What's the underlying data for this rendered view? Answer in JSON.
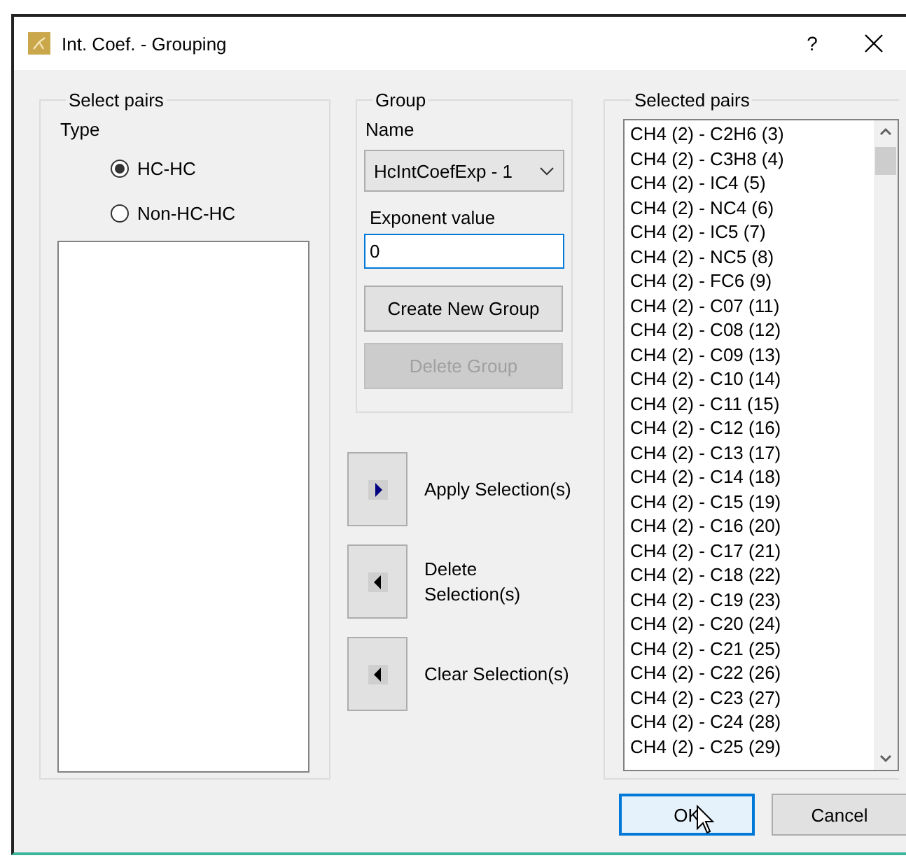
{
  "window": {
    "title": "Int. Coef. - Grouping",
    "help": "?"
  },
  "select_pairs": {
    "title": "Select pairs",
    "type_label": "Type",
    "options": [
      {
        "label": "HC-HC",
        "selected": true
      },
      {
        "label": "Non-HC-HC",
        "selected": false
      }
    ]
  },
  "group": {
    "title": "Group",
    "name_label": "Name",
    "name_value": "HcIntCoefExp - 1",
    "exponent_label": "Exponent value",
    "exponent_value": "0",
    "buttons": [
      {
        "label": "Create New Group",
        "disabled": false
      },
      {
        "label": "Delete Group",
        "disabled": true
      }
    ]
  },
  "actions": [
    {
      "label": "Apply Selection(s)",
      "kind": "right"
    },
    {
      "label": "Delete Selection(s)",
      "kind": "left"
    },
    {
      "label": "Clear Selection(s)",
      "kind": "left"
    }
  ],
  "selected_pairs": {
    "title": "Selected pairs",
    "items": [
      "CH4 (2) - C2H6 (3)",
      "CH4 (2) - C3H8 (4)",
      "CH4 (2) - IC4 (5)",
      "CH4 (2) - NC4 (6)",
      "CH4 (2) - IC5 (7)",
      "CH4 (2) - NC5 (8)",
      "CH4 (2) - FC6 (9)",
      "CH4 (2) - C07 (11)",
      "CH4 (2) - C08 (12)",
      "CH4 (2) - C09 (13)",
      "CH4 (2) - C10 (14)",
      "CH4 (2) - C11 (15)",
      "CH4 (2) - C12 (16)",
      "CH4 (2) - C13 (17)",
      "CH4 (2) - C14 (18)",
      "CH4 (2) - C15 (19)",
      "CH4 (2) - C16 (20)",
      "CH4 (2) - C17 (21)",
      "CH4 (2) - C18 (22)",
      "CH4 (2) - C19 (23)",
      "CH4 (2) - C20 (24)",
      "CH4 (2) - C21 (25)",
      "CH4 (2) - C22 (26)",
      "CH4 (2) - C23 (27)",
      "CH4 (2) - C24 (28)",
      "CH4 (2) - C25 (29)"
    ]
  },
  "buttons": [
    {
      "label": "OK",
      "default": true
    },
    {
      "label": "Cancel",
      "default": false
    }
  ]
}
